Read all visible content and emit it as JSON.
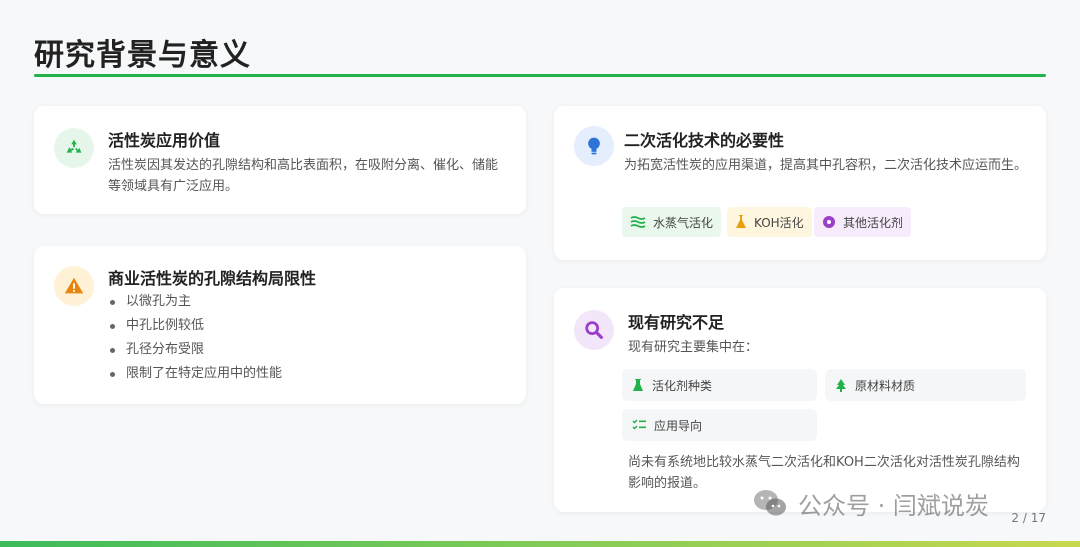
{
  "slide": {
    "title": "研究背景与意义",
    "page_number": "2 / 17",
    "watermark": "公众号 · 闫斌说炭"
  },
  "cards": {
    "value": {
      "icon": "recycle-icon",
      "title": "活性炭应用价值",
      "text": "活性炭因其发达的孔隙结构和高比表面积，在吸附分离、催化、储能等领域具有广泛应用。"
    },
    "limits": {
      "icon": "warning-icon",
      "title": "商业活性炭的孔隙结构局限性",
      "bullets": [
        "以微孔为主",
        "中孔比例较低",
        "孔径分布受限",
        "限制了在特定应用中的性能"
      ]
    },
    "necessity": {
      "icon": "lightbulb-icon",
      "title": "二次活化技术的必要性",
      "text": "为拓宽活性炭的应用渠道，提高其中孔容积，二次活化技术应运而生。",
      "tags": [
        {
          "icon": "steam-icon",
          "label": "水蒸气活化"
        },
        {
          "icon": "flask-icon",
          "label": "KOH活化"
        },
        {
          "icon": "atom-icon",
          "label": "其他活化剂"
        }
      ]
    },
    "gaps": {
      "icon": "search-icon",
      "title": "现有研究不足",
      "intro": "现有研究主要集中在：",
      "chips": [
        {
          "icon": "beaker-icon",
          "label": "活化剂种类"
        },
        {
          "icon": "tree-icon",
          "label": "原材料材质"
        },
        {
          "icon": "checklist-icon",
          "label": "应用导向"
        }
      ],
      "conclusion": "尚未有系统地比较水蒸气二次活化和KOH二次活化对活性炭孔隙结构影响的报道。"
    }
  },
  "colors": {
    "accent": "#21b24b",
    "green_bg": "#e6f6ea",
    "orange": "#e8850c",
    "orange_bg": "#fff1d6",
    "blue": "#2f73d9",
    "blue_bg": "#e4eefc",
    "purple": "#9b3ec8",
    "purple_bg": "#f3e6fa"
  }
}
